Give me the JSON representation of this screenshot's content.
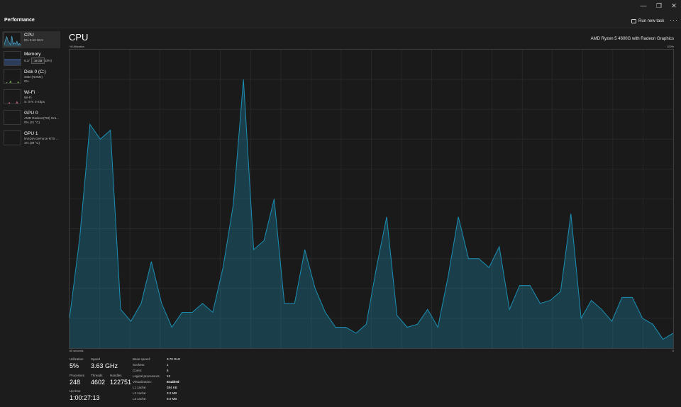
{
  "window": {
    "controls": [
      "—",
      "❐",
      "✕"
    ]
  },
  "header": {
    "title": "Performance",
    "run_new_task": "Run new task",
    "more": "···"
  },
  "sidebar": {
    "items": [
      {
        "name": "CPU",
        "sub": "5% 3.63 GHz",
        "sub2": "",
        "color": "#4aa3c7"
      },
      {
        "name": "Memory",
        "sub": "6.1/",
        "sub2": "(53%)",
        "color": "#4f7fd0"
      },
      {
        "name": "Disk 0 (C:)",
        "sub": "SSD (NVMe)",
        "sub2": "0%",
        "color": "#7ab65a"
      },
      {
        "name": "Wi-Fi",
        "sub": "Wi-Fi",
        "sub2": "S: 0 R: 0 Kbps",
        "color": "#c06090"
      },
      {
        "name": "GPU 0",
        "sub": "AMD Radeon(TM) Gra...",
        "sub2": "0% (41 °C)",
        "color": "#8a6ac0"
      },
      {
        "name": "GPU 1",
        "sub": "NVIDIA GeForce RTX ...",
        "sub2": "1% (39 °C)",
        "color": "#8a6ac0"
      }
    ],
    "tooltip": "16 GB"
  },
  "main": {
    "title": "CPU",
    "cpu_model": "AMD Ryzen 5 4600G with Radeon Graphics",
    "axis_label": "% Utilization",
    "axis_max": "100%",
    "time_label": "60 seconds",
    "axis_min": "0"
  },
  "stats": {
    "utilization_label": "Utilization",
    "utilization": "5%",
    "speed_label": "Speed",
    "speed": "3.63 GHz",
    "processes_label": "Processes",
    "processes": "248",
    "threads_label": "Threads",
    "threads": "4602",
    "handles_label": "Handles",
    "handles": "122751",
    "uptime_label": "Up time",
    "uptime": "1:00:27:13"
  },
  "specs": [
    {
      "k": "Base speed:",
      "v": "3.70 GHz"
    },
    {
      "k": "Sockets:",
      "v": "1"
    },
    {
      "k": "Cores:",
      "v": "6"
    },
    {
      "k": "Logical processors:",
      "v": "12"
    },
    {
      "k": "Virtualization:",
      "v": "Enabled"
    },
    {
      "k": "L1 cache:",
      "v": "384 KB"
    },
    {
      "k": "L2 cache:",
      "v": "3.0 MB"
    },
    {
      "k": "L3 cache:",
      "v": "8.0 MB"
    }
  ],
  "chart_data": {
    "type": "area",
    "color": "#1b8fb3",
    "ylim": [
      0,
      100
    ],
    "values": [
      10,
      37,
      75,
      70,
      73,
      13,
      9,
      15,
      29,
      15,
      7,
      12,
      12,
      15,
      12,
      27,
      48,
      90,
      33,
      36,
      50,
      15,
      15,
      33,
      20,
      12,
      7,
      7,
      5,
      8,
      27,
      44,
      11,
      7,
      8,
      13,
      7,
      24,
      44,
      30,
      30,
      27,
      34,
      13,
      21,
      21,
      15,
      16,
      19,
      45,
      10,
      16,
      13,
      9,
      17,
      17,
      10,
      8,
      3,
      5
    ]
  }
}
